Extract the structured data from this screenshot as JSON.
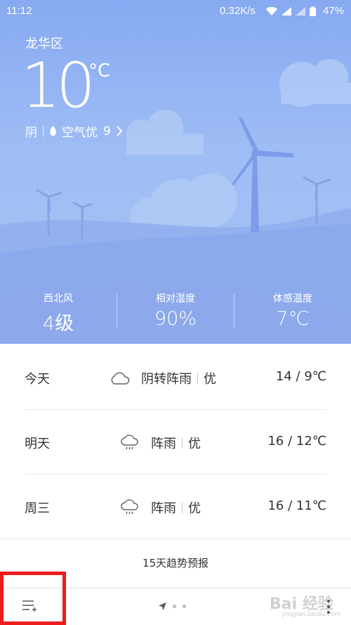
{
  "status_bar": {
    "time": "11:12",
    "net_speed": "0.32K/s",
    "battery": "47%"
  },
  "weather": {
    "district": "龙华区",
    "temperature": "10",
    "unit": "°C",
    "condition": "阴",
    "air_quality": "空气优",
    "aqi": "9"
  },
  "stats": [
    {
      "label": "西北风",
      "value": "4级"
    },
    {
      "label": "相对湿度",
      "value": "90%"
    },
    {
      "label": "体感温度",
      "value": "7℃"
    }
  ],
  "forecast": [
    {
      "day": "今天",
      "icon": "cloud-icon",
      "desc": "阴转阵雨",
      "air": "优",
      "range": "14 / 9℃"
    },
    {
      "day": "明天",
      "icon": "rain-cloud-icon",
      "desc": "阵雨",
      "air": "优",
      "range": "16 / 12℃"
    },
    {
      "day": "周三",
      "icon": "rain-cloud-icon",
      "desc": "阵雨",
      "air": "优",
      "range": "16 / 11℃"
    }
  ],
  "trend_link": "15天趋势预报",
  "watermark": {
    "main": "Bai 经验",
    "sub": "jingyan.baidu.com"
  },
  "colors": {
    "sky": "#86a9f1",
    "hill": "#7d9ce8",
    "highlight_box": "#ee1c1c"
  }
}
